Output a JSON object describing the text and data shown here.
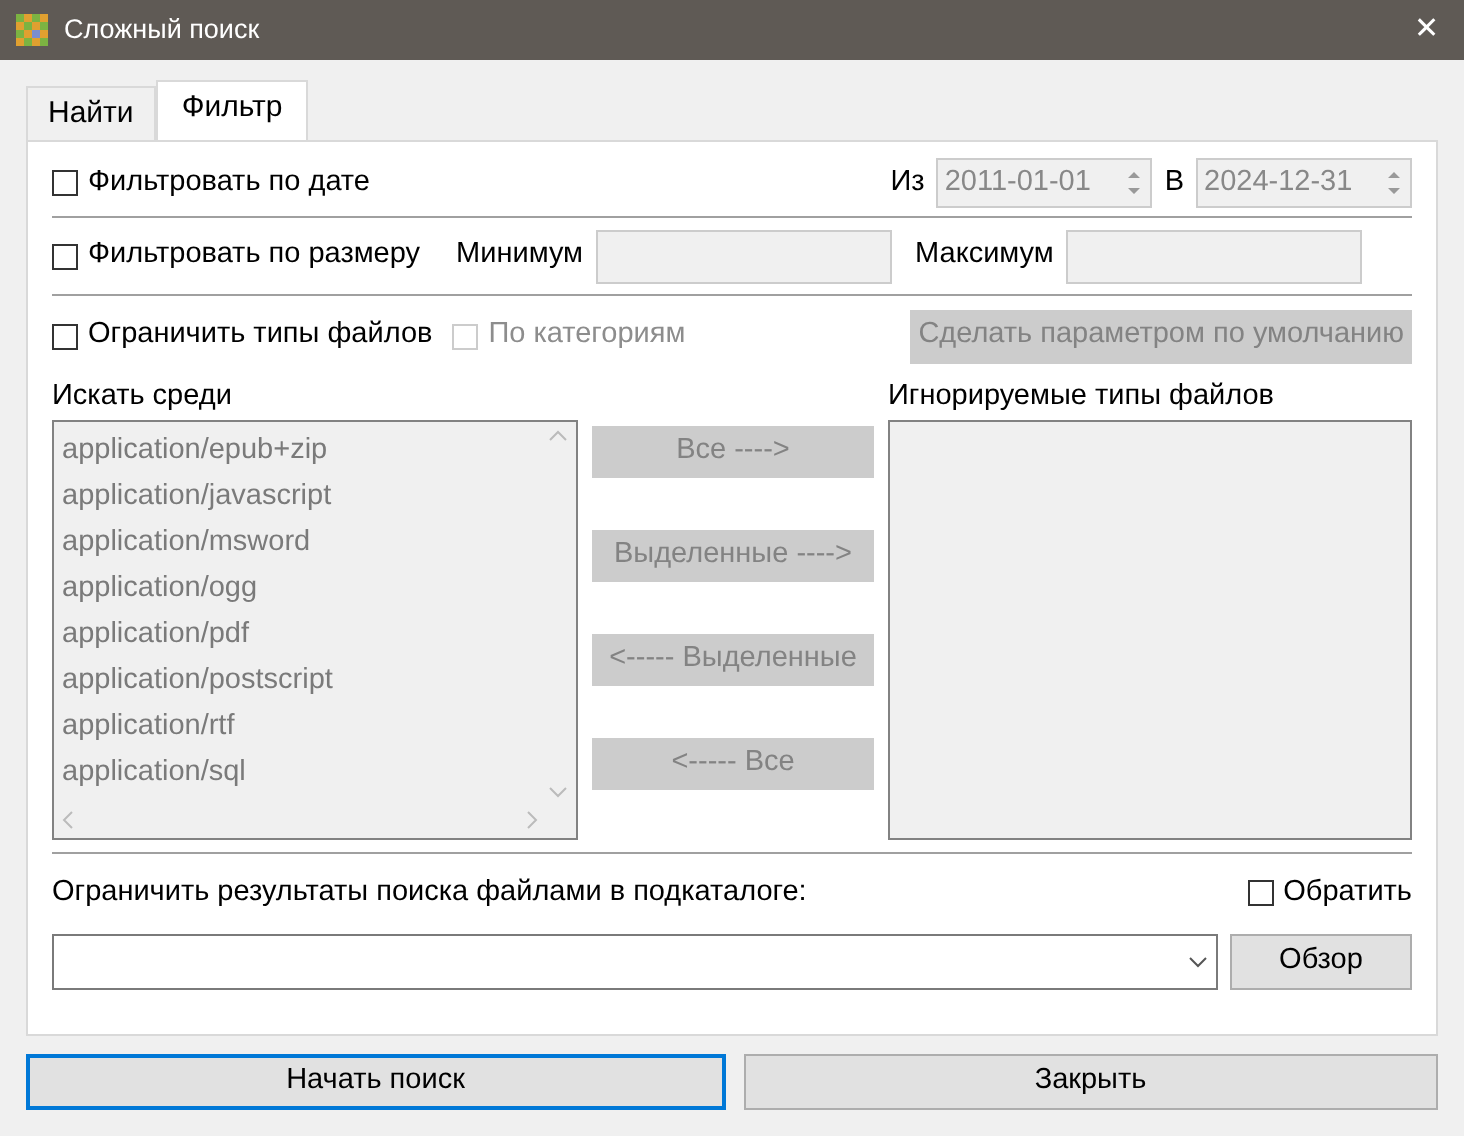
{
  "window": {
    "title": "Сложный поиск",
    "close": "✕"
  },
  "tabs": [
    {
      "label": "Найти",
      "selected": false
    },
    {
      "label": "Фильтр",
      "selected": true
    }
  ],
  "date_filter": {
    "label": "Фильтровать по дате",
    "checked": false,
    "from_label": "Из",
    "from_value": "2011-01-01",
    "to_label": "В",
    "to_value": "2024-12-31",
    "disabled": true
  },
  "size_filter": {
    "label": "Фильтровать по размеру",
    "checked": false,
    "min_label": "Минимум",
    "max_label": "Максимум",
    "disabled": true
  },
  "type_filter": {
    "label": "Ограничить типы файлов",
    "checked": false,
    "by_category": {
      "label": "По категориям",
      "checked": false,
      "disabled": true
    },
    "default_button": {
      "label": "Сделать параметром по умолчанию",
      "disabled": true
    }
  },
  "search_among": {
    "label": "Искать среди",
    "disabled": true,
    "items": [
      "application/epub+zip",
      "application/javascript",
      "application/msword",
      "application/ogg",
      "application/pdf",
      "application/postscript",
      "application/rtf",
      "application/sql"
    ]
  },
  "transfer_buttons": [
    {
      "label": "Все ---->",
      "disabled": true
    },
    {
      "label": "Выделенные ---->",
      "disabled": true
    },
    {
      "label": "<----- Выделенные",
      "disabled": true
    },
    {
      "label": "<----- Все",
      "disabled": true
    }
  ],
  "ignored": {
    "label": "Игнорируемые типы файлов",
    "disabled": true
  },
  "subdir": {
    "label": "Ограничить результаты поиска файлами в подкаталоге:",
    "invert": {
      "label": "Обратить",
      "checked": false
    },
    "browse_button": "Обзор"
  },
  "buttons": [
    {
      "label": "Начать поиск",
      "focused": true
    },
    {
      "label": "Закрыть",
      "focused": false
    }
  ]
}
